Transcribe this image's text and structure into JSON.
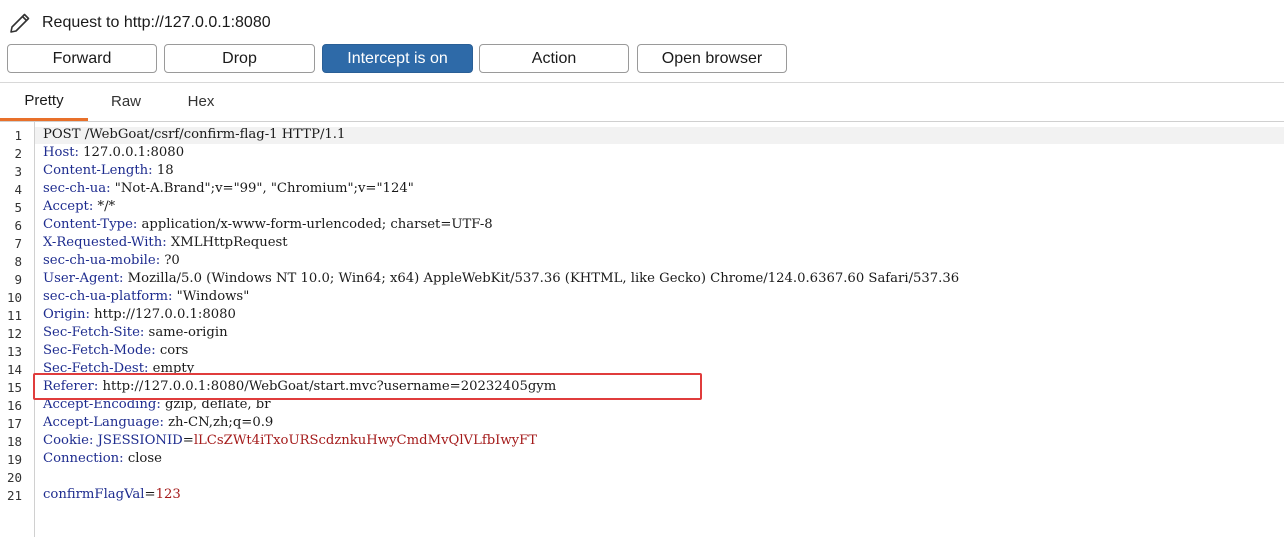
{
  "header": {
    "title": "Request to http://127.0.0.1:8080",
    "icon": "pencil-icon"
  },
  "toolbar": {
    "forward": "Forward",
    "drop": "Drop",
    "intercept": "Intercept is on",
    "action": "Action",
    "open_browser": "Open browser"
  },
  "tabs": {
    "pretty": "Pretty",
    "raw": "Raw",
    "hex": "Hex"
  },
  "editor": {
    "line_numbers": [
      "1",
      "2",
      "3",
      "4",
      "5",
      "6",
      "7",
      "8",
      "9",
      "10",
      "11",
      "12",
      "13",
      "14",
      "15",
      "16",
      "17",
      "18",
      "19",
      "20",
      "21"
    ],
    "request_line": "POST /WebGoat/csrf/confirm-flag-1 HTTP/1.1",
    "headers": [
      {
        "name": "Host",
        "value": "127.0.0.1:8080"
      },
      {
        "name": "Content-Length",
        "value": "18"
      },
      {
        "name": "sec-ch-ua",
        "value": "\"Not-A.Brand\";v=\"99\", \"Chromium\";v=\"124\""
      },
      {
        "name": "Accept",
        "value": "*/*"
      },
      {
        "name": "Content-Type",
        "value": "application/x-www-form-urlencoded; charset=UTF-8"
      },
      {
        "name": "X-Requested-With",
        "value": "XMLHttpRequest"
      },
      {
        "name": "sec-ch-ua-mobile",
        "value": "?0"
      },
      {
        "name": "User-Agent",
        "value": "Mozilla/5.0 (Windows NT 10.0; Win64; x64) AppleWebKit/537.36 (KHTML, like Gecko) Chrome/124.0.6367.60 Safari/537.36"
      },
      {
        "name": "sec-ch-ua-platform",
        "value": "\"Windows\""
      },
      {
        "name": "Origin",
        "value": "http://127.0.0.1:8080"
      },
      {
        "name": "Sec-Fetch-Site",
        "value": "same-origin"
      },
      {
        "name": "Sec-Fetch-Mode",
        "value": "cors"
      },
      {
        "name": "Sec-Fetch-Dest",
        "value": "empty"
      },
      {
        "name": "Referer",
        "value": "http://127.0.0.1:8080/WebGoat/start.mvc?username=20232405gym"
      },
      {
        "name": "Accept-Encoding",
        "value": "gzip, deflate, br"
      },
      {
        "name": "Accept-Language",
        "value": "zh-CN,zh;q=0.9"
      }
    ],
    "cookie": {
      "name": "Cookie",
      "cookie_name": "JSESSIONID",
      "cookie_value": "lLCsZWt4iTxoURScdznkuHwyCmdMvQlVLfbIwyFT"
    },
    "connection": {
      "name": "Connection",
      "value": "close"
    },
    "body": {
      "param": "confirmFlagVal",
      "value": "123"
    }
  },
  "colors": {
    "accent_tab": "#e8702a",
    "intercept_button": "#2e6aa8",
    "highlight_box": "#e03c3c",
    "header_name": "#1e2c8f",
    "param_value": "#a41b1b"
  }
}
